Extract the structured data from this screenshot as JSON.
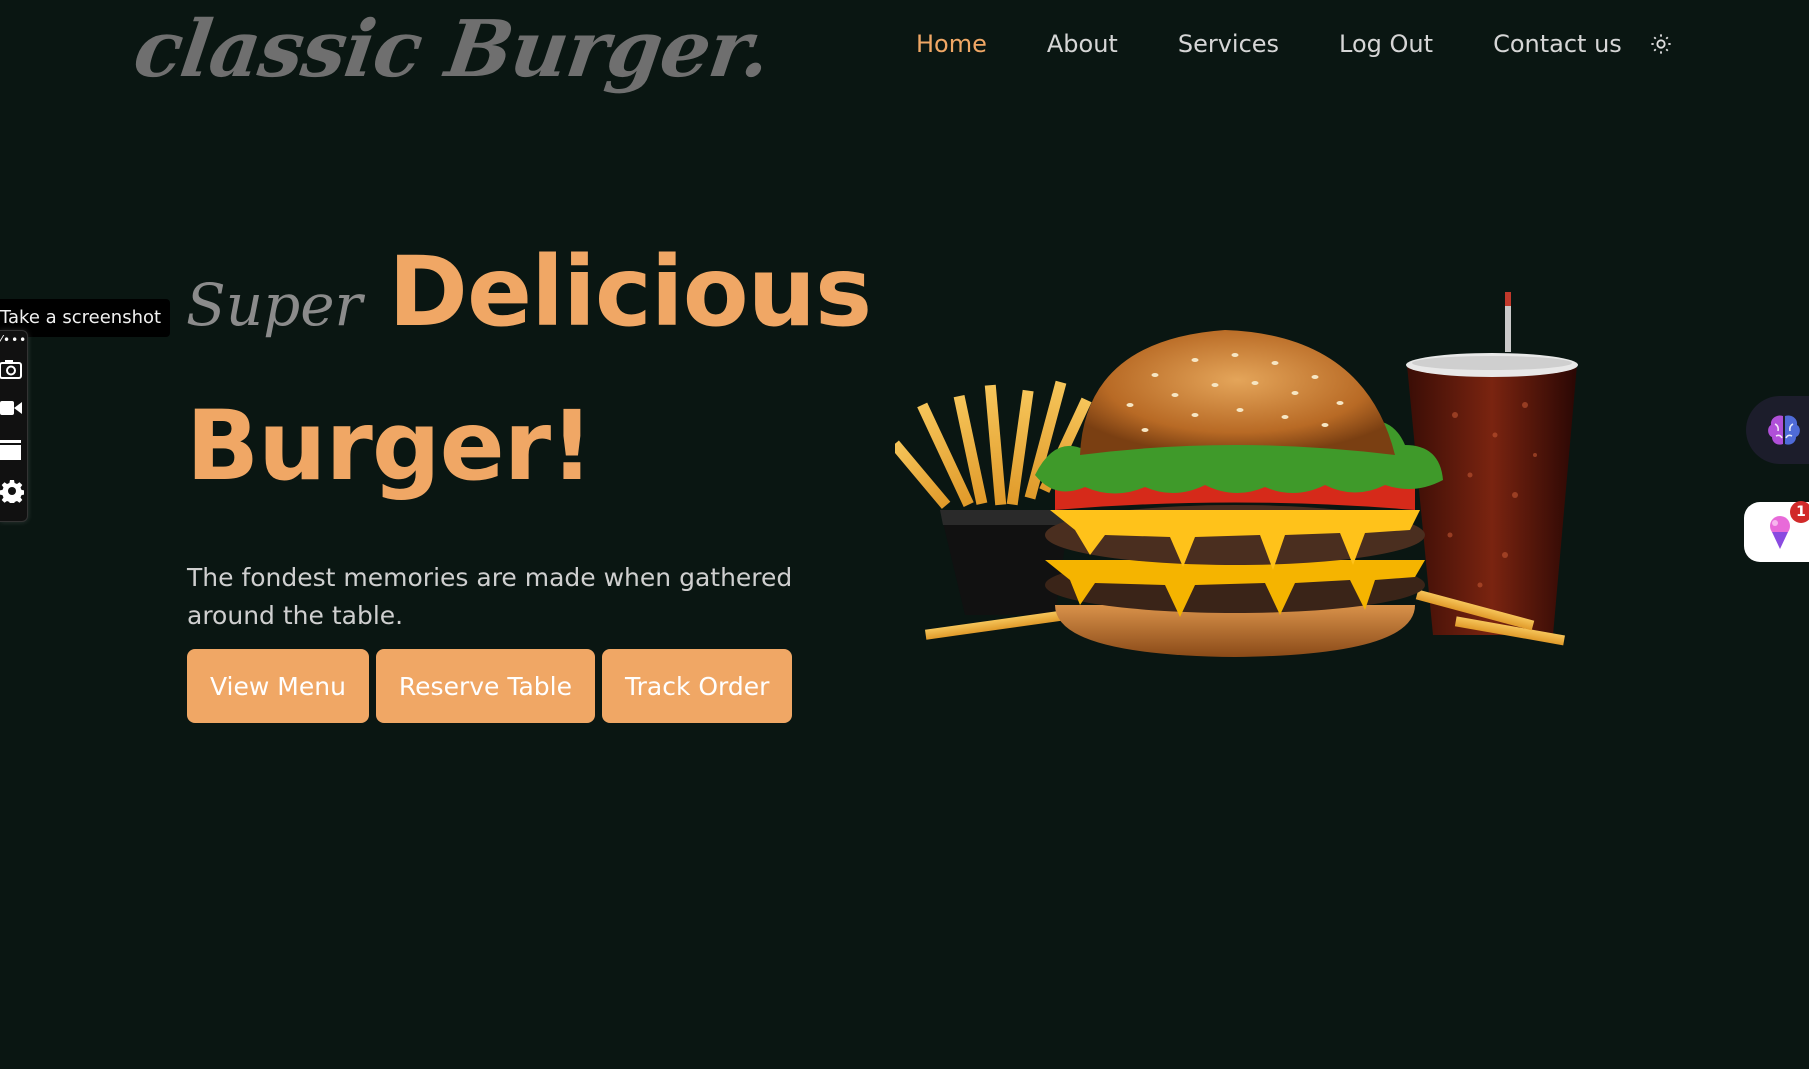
{
  "header": {
    "logo_text": "classic Burger.",
    "nav": [
      {
        "label": "Home",
        "active": true
      },
      {
        "label": "About",
        "active": false
      },
      {
        "label": "Services",
        "active": false
      },
      {
        "label": "Log Out",
        "active": false
      },
      {
        "label": "Contact us",
        "active": false
      }
    ],
    "theme_icon": "sun-icon"
  },
  "hero": {
    "super_word": "Super",
    "title_line1": "Delicious",
    "title_line2": "Burger!",
    "description": "The fondest memories are made when gathered around the table.",
    "buttons": [
      "View Menu",
      "Reserve Table",
      "Track Order"
    ],
    "image_subject": "burger with fries and cola"
  },
  "screenshot_tool": {
    "tooltip": "Take a screenshot",
    "tools": [
      "camera-icon",
      "video-icon",
      "window-icon",
      "gear-icon"
    ]
  },
  "extensions": {
    "brain_icon": "brain-icon",
    "icecream_icon": "ice-cream-icon",
    "badge_count": "1"
  },
  "colors": {
    "background": "#0a1612",
    "accent": "#f0a765",
    "logo_gray": "#6f6f6f",
    "nav_text": "#d6d6d6",
    "badge_red": "#d12a2a"
  }
}
